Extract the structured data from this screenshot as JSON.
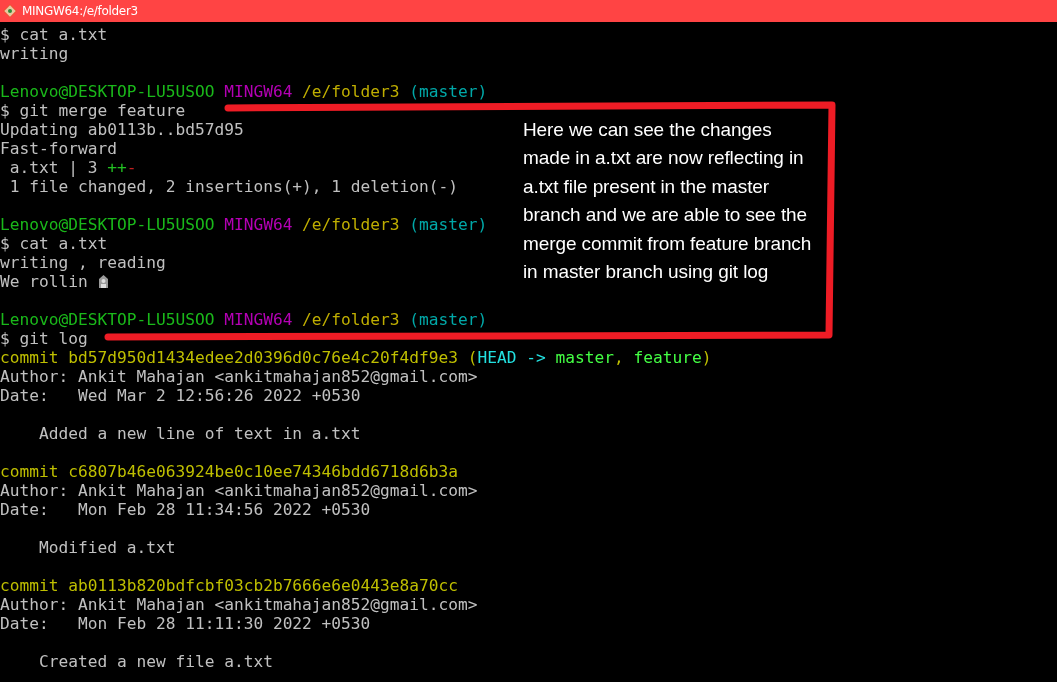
{
  "window": {
    "title": "MINGW64:/e/folder3"
  },
  "terminal": {
    "lines": [
      {
        "kind": "text",
        "segments": [
          {
            "kind": "plain",
            "text": "$ cat a.txt"
          }
        ]
      },
      {
        "kind": "text",
        "segments": [
          {
            "kind": "plain",
            "text": "writing"
          }
        ]
      },
      {
        "kind": "blank"
      },
      {
        "kind": "text",
        "segments": [
          {
            "kind": "user",
            "text": "Lenovo@DESKTOP-LU5USOO"
          },
          {
            "kind": "host",
            "text": " MINGW64"
          },
          {
            "kind": "path",
            "text": " /e/folder3"
          },
          {
            "kind": "branch",
            "text": " (master)"
          }
        ]
      },
      {
        "kind": "text",
        "segments": [
          {
            "kind": "plain",
            "text": "$ git merge feature"
          }
        ]
      },
      {
        "kind": "text",
        "segments": [
          {
            "kind": "plain",
            "text": "Updating ab0113b..bd57d95"
          }
        ]
      },
      {
        "kind": "text",
        "segments": [
          {
            "kind": "plain",
            "text": "Fast-forward"
          }
        ]
      },
      {
        "kind": "text",
        "segments": [
          {
            "kind": "plain",
            "text": " a.txt | 3"
          },
          {
            "kind": "added",
            "text": " ++"
          },
          {
            "kind": "removed",
            "text": "-"
          }
        ]
      },
      {
        "kind": "text",
        "segments": [
          {
            "kind": "plain",
            "text": " 1 file changed, 2 insertions(+), 1 deletion(-)"
          }
        ]
      },
      {
        "kind": "blank"
      },
      {
        "kind": "text",
        "segments": [
          {
            "kind": "user",
            "text": "Lenovo@DESKTOP-LU5USOO"
          },
          {
            "kind": "host",
            "text": " MINGW64"
          },
          {
            "kind": "path",
            "text": " /e/folder3"
          },
          {
            "kind": "branch",
            "text": " (master)"
          }
        ]
      },
      {
        "kind": "text",
        "segments": [
          {
            "kind": "plain",
            "text": "$ cat a.txt"
          }
        ]
      },
      {
        "kind": "text",
        "segments": [
          {
            "kind": "plain",
            "text": "writing , reading"
          }
        ]
      },
      {
        "kind": "text",
        "segments": [
          {
            "kind": "plain",
            "text": "We rollin"
          },
          {
            "kind": "icon"
          }
        ]
      },
      {
        "kind": "blank"
      },
      {
        "kind": "text",
        "segments": [
          {
            "kind": "user",
            "text": "Lenovo@DESKTOP-LU5USOO"
          },
          {
            "kind": "host",
            "text": " MINGW64"
          },
          {
            "kind": "path",
            "text": " /e/folder3"
          },
          {
            "kind": "branch",
            "text": " (master)"
          }
        ]
      },
      {
        "kind": "text",
        "segments": [
          {
            "kind": "plain",
            "text": "$ git log"
          }
        ]
      },
      {
        "kind": "text",
        "segments": [
          {
            "kind": "commit",
            "text": "commit bd57d950d1434edee2d0396d0c76e4c20f4df9e3 ("
          },
          {
            "kind": "head",
            "text": "HEAD -> "
          },
          {
            "kind": "ref",
            "text": "master"
          },
          {
            "kind": "commit",
            "text": ", "
          },
          {
            "kind": "ref",
            "text": "feature"
          },
          {
            "kind": "commit",
            "text": ")"
          }
        ]
      },
      {
        "kind": "text",
        "segments": [
          {
            "kind": "plain",
            "text": "Author: Ankit Mahajan <ankitmahajan852@gmail.com>"
          }
        ]
      },
      {
        "kind": "text",
        "segments": [
          {
            "kind": "plain",
            "text": "Date:   Wed Mar 2 12:56:26 2022 +0530"
          }
        ]
      },
      {
        "kind": "blank"
      },
      {
        "kind": "text",
        "segments": [
          {
            "kind": "plain",
            "text": "    Added a new line of text in a.txt"
          }
        ]
      },
      {
        "kind": "blank"
      },
      {
        "kind": "text",
        "segments": [
          {
            "kind": "commit",
            "text": "commit c6807b46e063924be0c10ee74346bdd6718d6b3a"
          }
        ]
      },
      {
        "kind": "text",
        "segments": [
          {
            "kind": "plain",
            "text": "Author: Ankit Mahajan <ankitmahajan852@gmail.com>"
          }
        ]
      },
      {
        "kind": "text",
        "segments": [
          {
            "kind": "plain",
            "text": "Date:   Mon Feb 28 11:34:56 2022 +0530"
          }
        ]
      },
      {
        "kind": "blank"
      },
      {
        "kind": "text",
        "segments": [
          {
            "kind": "plain",
            "text": "    Modified a.txt"
          }
        ]
      },
      {
        "kind": "blank"
      },
      {
        "kind": "text",
        "segments": [
          {
            "kind": "commit",
            "text": "commit ab0113b820bdfcbf03cb2b7666e6e0443e8a70cc"
          }
        ]
      },
      {
        "kind": "text",
        "segments": [
          {
            "kind": "plain",
            "text": "Author: Ankit Mahajan <ankitmahajan852@gmail.com>"
          }
        ]
      },
      {
        "kind": "text",
        "segments": [
          {
            "kind": "plain",
            "text": "Date:   Mon Feb 28 11:11:30 2022 +0530"
          }
        ]
      },
      {
        "kind": "blank"
      },
      {
        "kind": "text",
        "segments": [
          {
            "kind": "plain",
            "text": "    Created a new file a.txt"
          }
        ]
      }
    ]
  },
  "annotation": {
    "text": "Here we can see the changes made in a.txt are now reflecting in a.txt file present in the master branch and we are able to see the merge commit from feature branch in master branch using git log"
  }
}
